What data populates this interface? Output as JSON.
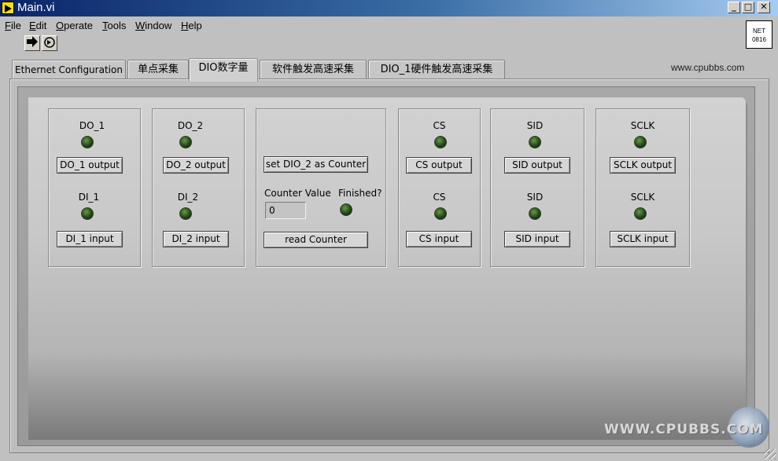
{
  "window": {
    "title": "Main.vi",
    "minimize": "_",
    "maximize": "□",
    "close": "✕"
  },
  "menu": [
    "File",
    "Edit",
    "Operate",
    "Tools",
    "Window",
    "Help"
  ],
  "toolbar": {
    "run_icon": "run-arrow-icon",
    "run_continuous_icon": "run-continuously-icon",
    "net_badge": [
      "NET",
      "0816"
    ]
  },
  "website": "www.cpubbs.com",
  "tabs": [
    "Ethernet Configuration",
    "单点采集",
    "DIO数字量",
    "软件触发高速采集",
    "DIO_1硬件触发高速采集"
  ],
  "active_tab": "DIO数字量",
  "dio": {
    "do1": {
      "label": "DO_1",
      "button": "DO_1 output",
      "in_label": "DI_1",
      "in_button": "DI_1 input"
    },
    "do2": {
      "label": "DO_2",
      "button": "DO_2 output",
      "in_label": "DI_2",
      "in_button": "DI_2 input"
    },
    "counter": {
      "set_button": "set DIO_2 as Counter",
      "value_label": "Counter Value",
      "finished_label": "Finished?",
      "value": "0",
      "read_button": "read Counter"
    },
    "cs": {
      "label": "CS",
      "button": "CS output",
      "in_label": "CS",
      "in_button": "CS input"
    },
    "sid": {
      "label": "SID",
      "button": "SID output",
      "in_label": "SID",
      "in_button": "SID input"
    },
    "sclk": {
      "label": "SCLK",
      "button": "SCLK output",
      "in_label": "SCLK",
      "in_button": "SCLK input"
    }
  },
  "colors": {
    "led_off": "#1f4a12",
    "panel": "#c0c0c0",
    "titlebar": "#0a246a"
  },
  "watermark": "WWW.CPUBBS.COM"
}
